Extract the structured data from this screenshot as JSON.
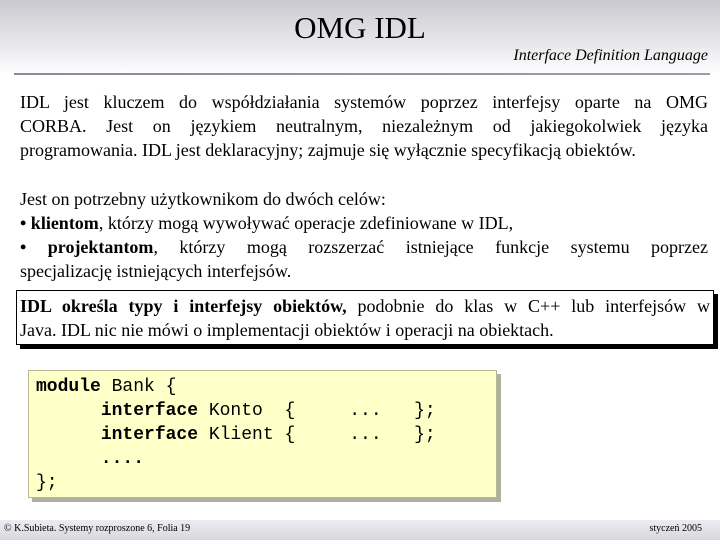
{
  "header": {
    "title": "OMG IDL",
    "subtitle": "Interface Definition Language"
  },
  "paragraph1": {
    "lines": [
      "IDL jest kluczem do współdziałania systemów poprzez interfejsy oparte na OMG",
      "CORBA. Jest on językiem neutralnym, niezależnym od jakiegokolwiek języka",
      "programowania. IDL jest deklaracyjny; zajmuje się wyłącznie specyfikacją obiektów."
    ]
  },
  "paragraph2": {
    "intro": "Jest on potrzebny użytkownikom do dwóch celów:",
    "bullet1_bold": "• klientom",
    "bullet1_rest": ", którzy mogą wywoływać operacje zdefiniowane w IDL,",
    "bullet2_bold": "• projektantom",
    "bullet2_rest": ", którzy mogą rozszerzać istniejące funkcje systemu poprzez",
    "bullet2_cont": "specjalizację istniejących interfejsów."
  },
  "highlight": {
    "bold": "IDL określa typy i interfejsy obiektów,",
    "rest_line1": " podobnie do klas w C++ lub interfejsów w",
    "line2": "Java. IDL nic nie mówi o implementacji obiektów i operacji na obiektach."
  },
  "code": {
    "line1_kw": "module",
    "line1_rest": " Bank {",
    "line2_kw": "interface",
    "line2_rest": " Konto  {     ...   };",
    "line3_kw": "interface",
    "line3_rest": " Klient {     ...   };",
    "line4": "      ....",
    "line5": "};"
  },
  "footer": {
    "left": "© K.Subieta. Systemy rozproszone 6, Folia 19",
    "right": "styczeń 2005"
  }
}
